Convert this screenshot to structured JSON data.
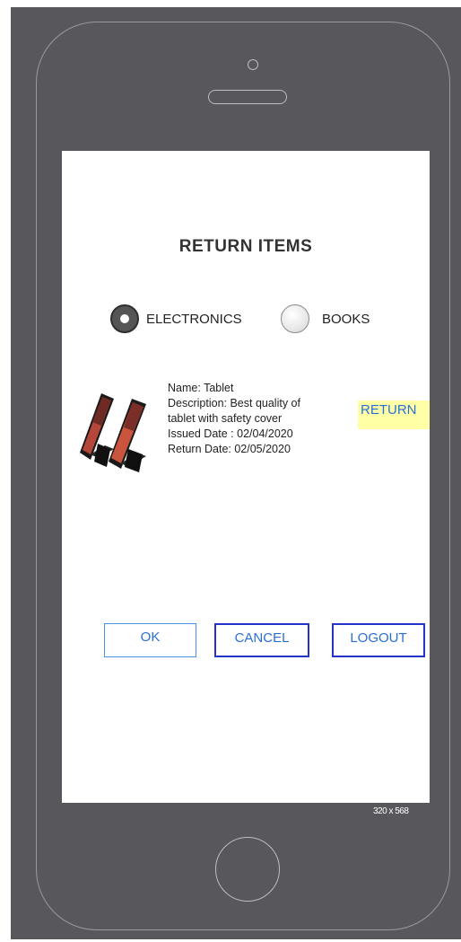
{
  "device": {
    "size_label": "320 x 568"
  },
  "screen": {
    "title": "RETURN ITEMS",
    "categories": [
      {
        "label": "ELECTRONICS",
        "selected": true
      },
      {
        "label": "BOOKS",
        "selected": false
      }
    ],
    "item": {
      "image": "tablet-icon",
      "name_line": "Name: Tablet",
      "description_line1": "Description: Best quality of",
      "description_line2": "tablet with safety cover",
      "issued_line": "Issued Date : 02/04/2020",
      "return_line": "Return Date: 02/05/2020",
      "action_label": "RETURN"
    },
    "buttons": {
      "ok": "OK",
      "cancel": "CANCEL",
      "logout": "LOGOUT"
    }
  },
  "colors": {
    "device_frame": "#58575c",
    "link_blue": "#2a6fd6",
    "highlight": "#ffffa6",
    "button_border": "#2433c8"
  }
}
